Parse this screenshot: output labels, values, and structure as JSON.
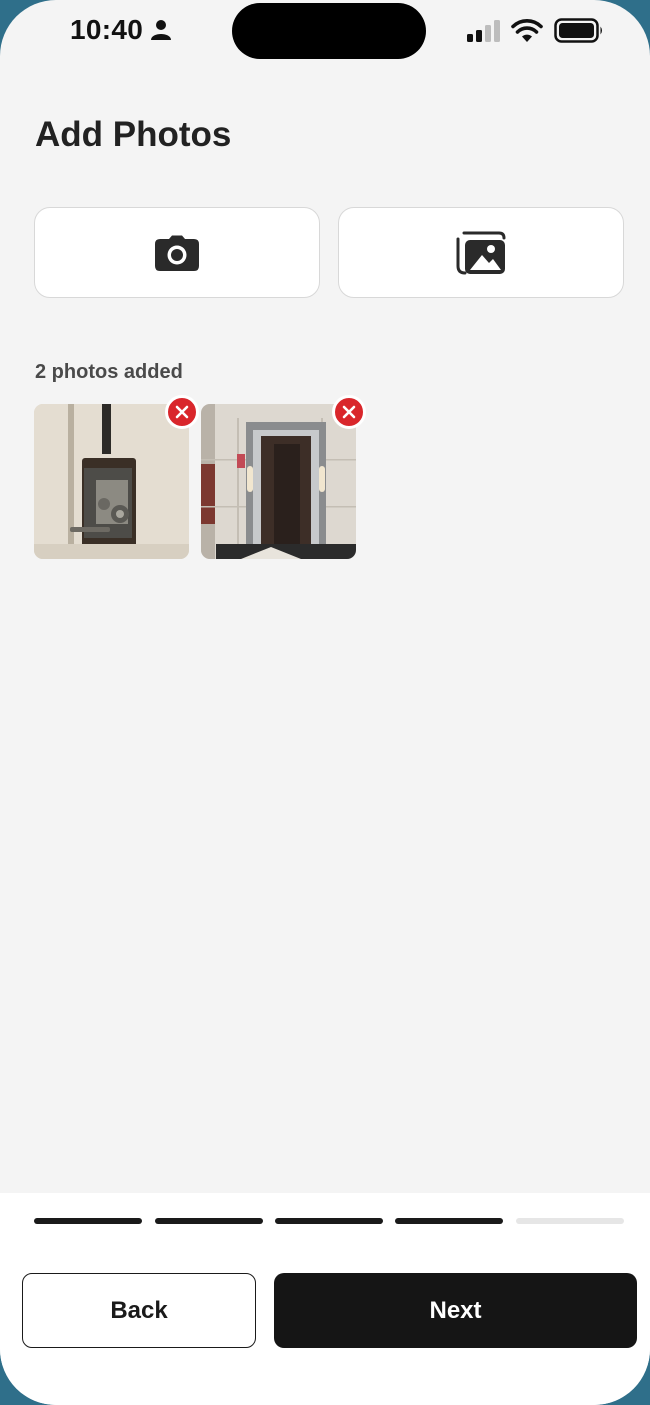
{
  "status_bar": {
    "time": "10:40",
    "icons": [
      "person-icon",
      "signal-icon",
      "wifi-icon",
      "battery-icon"
    ]
  },
  "page": {
    "title": "Add Photos"
  },
  "photo_sources": [
    {
      "icon": "camera-icon",
      "action": "take-photo"
    },
    {
      "icon": "gallery-icon",
      "action": "choose-from-library"
    }
  ],
  "photos": {
    "count_label": "2 photos added",
    "items": [
      {
        "subject": "door lock mechanism",
        "remove_icon": "close-icon"
      },
      {
        "subject": "elevator doorway",
        "remove_icon": "close-icon"
      }
    ]
  },
  "progress": {
    "total_steps": 5,
    "completed_steps": 4
  },
  "footer": {
    "back_label": "Back",
    "next_label": "Next"
  },
  "colors": {
    "primary": "#151515",
    "remove": "#d9262b",
    "background": "#f4f4f4"
  }
}
